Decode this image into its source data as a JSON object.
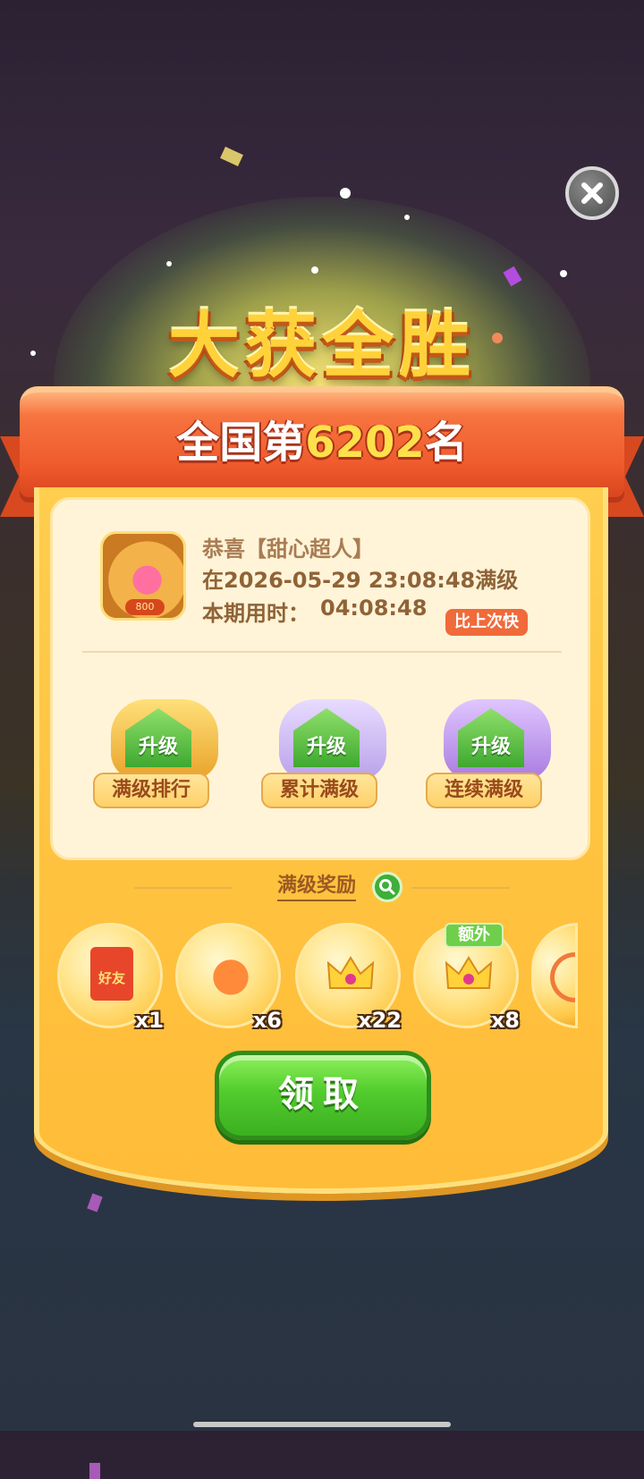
{
  "header": {
    "title": "大获全胜"
  },
  "rank": {
    "prefix": "全国第",
    "number": "6202",
    "suffix": "名"
  },
  "profile": {
    "avatar_badge": "800",
    "congrats": "恭喜【甜心超人】",
    "maxed_at": "在2026-05-29 23:08:48满级",
    "period_time_label": "本期用时：",
    "period_time_value": "04:08:48",
    "compare_badge": "比上次快"
  },
  "features": [
    {
      "tag": "升级",
      "label": "满级排行"
    },
    {
      "tag": "升级",
      "label": "累计满级"
    },
    {
      "tag": "升级",
      "label": "连续满级"
    }
  ],
  "rewards": {
    "title": "满级奖励",
    "items": [
      {
        "icon": "red-envelope-icon",
        "icon_text": "好友",
        "count": "x1"
      },
      {
        "icon": "fruit-wand-icon",
        "count": "x6"
      },
      {
        "icon": "crown-icon",
        "count": "x22"
      },
      {
        "icon": "crown-icon",
        "count": "x8",
        "extra_tag": "额外"
      },
      {
        "icon": "bow-icon",
        "count": ""
      }
    ]
  },
  "claim_button": {
    "label": "领取"
  },
  "colors": {
    "ribbon": "#ef5a2c",
    "card": "#ffc340",
    "claim": "#52cc2e",
    "title": "#ffd23a"
  }
}
